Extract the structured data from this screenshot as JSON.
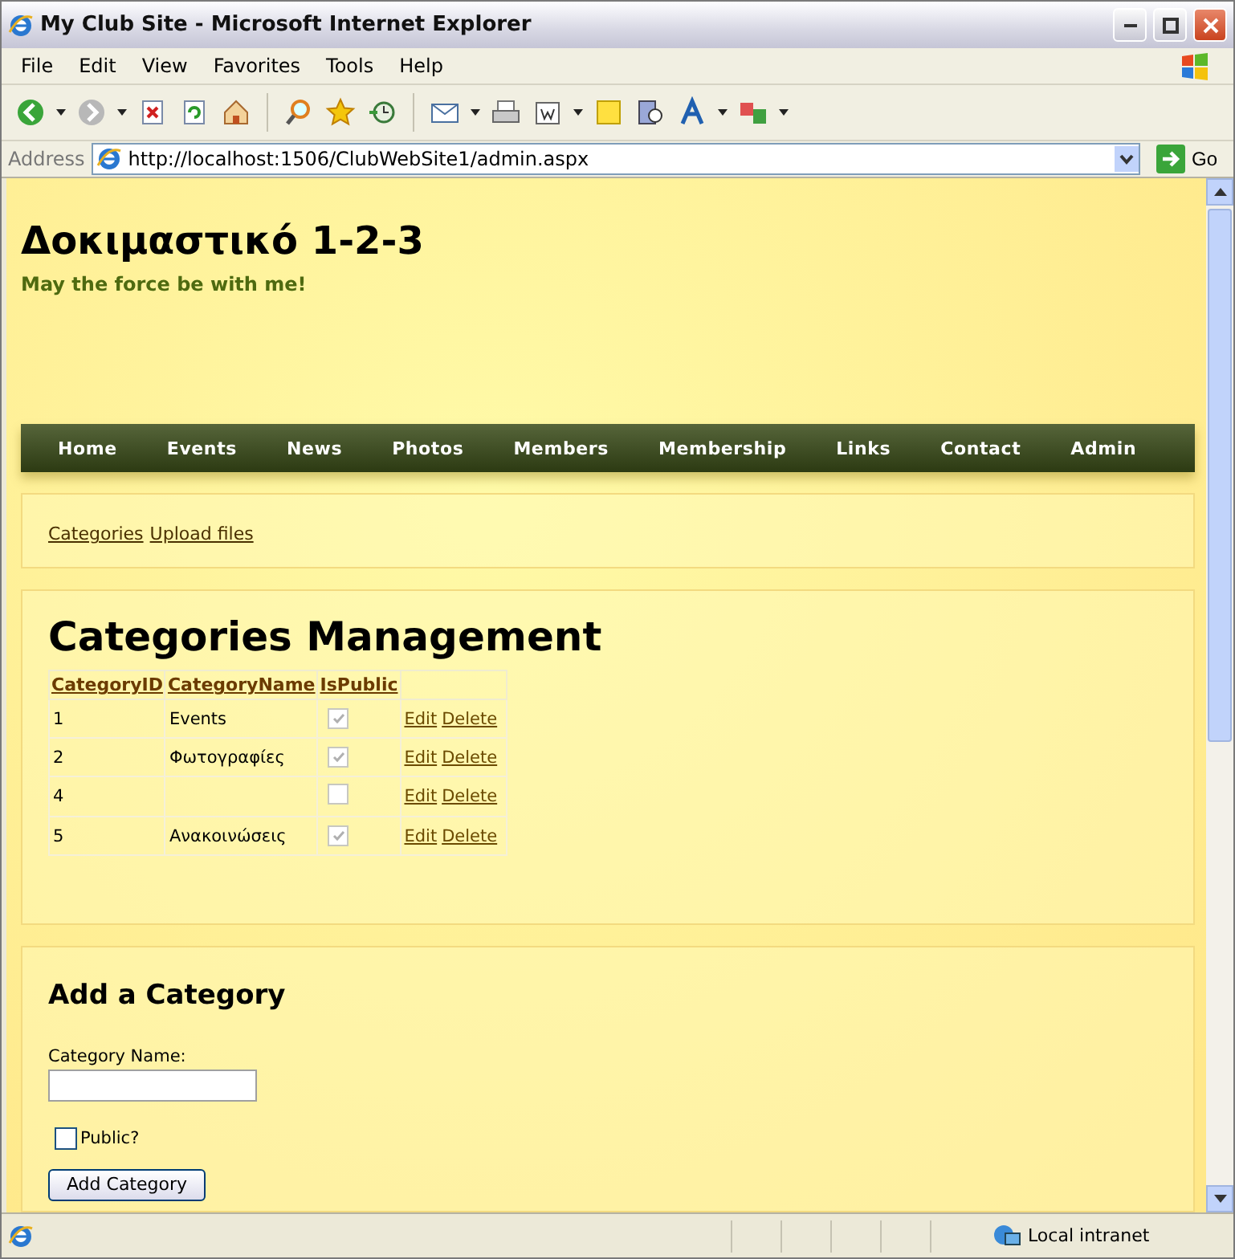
{
  "window": {
    "title": "My Club Site - Microsoft Internet Explorer"
  },
  "menu": [
    "File",
    "Edit",
    "View",
    "Favorites",
    "Tools",
    "Help"
  ],
  "address": {
    "label": "Address",
    "url": "http://localhost:1506/ClubWebSite1/admin.aspx",
    "go": "Go"
  },
  "site": {
    "title": "Δοκιμαστικό 1-2-3",
    "tagline": "May the force be with me!"
  },
  "nav": [
    "Home",
    "Events",
    "News",
    "Photos",
    "Members",
    "Membership",
    "Links",
    "Contact",
    "Admin"
  ],
  "subnav": [
    "Categories",
    "Upload files"
  ],
  "management": {
    "heading": "Categories Management",
    "columns": [
      "CategoryID",
      "CategoryName",
      "IsPublic"
    ],
    "rows": [
      {
        "id": "1",
        "name": "Events",
        "is_public": true,
        "actions": [
          "Edit",
          "Delete"
        ]
      },
      {
        "id": "2",
        "name": "Φωτογραφίες",
        "is_public": true,
        "actions": [
          "Edit",
          "Delete"
        ]
      },
      {
        "id": "4",
        "name": "",
        "is_public": false,
        "actions": [
          "Edit",
          "Delete"
        ]
      },
      {
        "id": "5",
        "name": "Ανακοινώσεις",
        "is_public": true,
        "actions": [
          "Edit",
          "Delete"
        ]
      }
    ]
  },
  "add_form": {
    "heading": "Add a Category",
    "field_label": "Category Name:",
    "public": {
      "label": "Public?",
      "checked": false
    },
    "button": "Add Category"
  },
  "status_bar": {
    "zone": "Local intranet"
  }
}
